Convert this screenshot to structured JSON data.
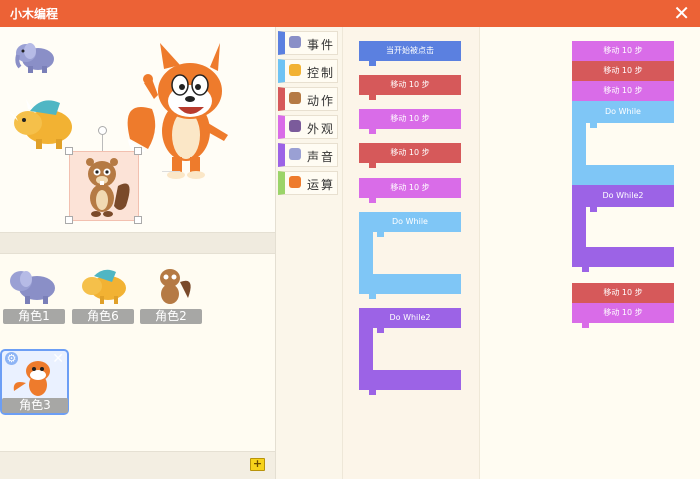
{
  "app": {
    "title": "小木编程",
    "close_icon": "close-icon"
  },
  "categories": [
    {
      "label": "事件",
      "color": "#5b80e0",
      "icon": "event-icon"
    },
    {
      "label": "控制",
      "color": "#6fc3f4",
      "icon": "control-icon"
    },
    {
      "label": "动作",
      "color": "#d6595a",
      "icon": "motion-icon"
    },
    {
      "label": "外观",
      "color": "#d96ce8",
      "icon": "looks-icon"
    },
    {
      "label": "声音",
      "color": "#9c63e6",
      "icon": "sound-icon"
    },
    {
      "label": "运算",
      "color": "#9bd469",
      "icon": "operator-icon"
    }
  ],
  "sprites": [
    {
      "label": "角色1",
      "icon": "elephant-icon"
    },
    {
      "label": "角色6",
      "icon": "triceratops-icon"
    },
    {
      "label": "角色2",
      "icon": "squirrel-icon"
    },
    {
      "label": "角色3",
      "icon": "fox-icon",
      "selected": true
    }
  ],
  "palette_blocks": {
    "when_clicked": "当开始被点击",
    "move1": "移动 10 步",
    "move2": "移动 10 步",
    "move3": "移动 10 步",
    "move4": "移动 10 步",
    "do_while": "Do While",
    "do_while2": "Do While2"
  },
  "workspace_blocks": {
    "move_a": "移动 10 步",
    "move_b": "移动 10 步",
    "move_c": "移动 10 步",
    "do_while": "Do While",
    "do_while2": "Do While2",
    "move_d": "移动 10 步",
    "move_e": "移动 10 步"
  },
  "colors": {
    "titlebar": "#ec6236",
    "event": "#5b80e0",
    "control": "#6fc3f4",
    "motion": "#d6595a",
    "looks": "#d96ce8",
    "sound": "#9c63e6"
  }
}
